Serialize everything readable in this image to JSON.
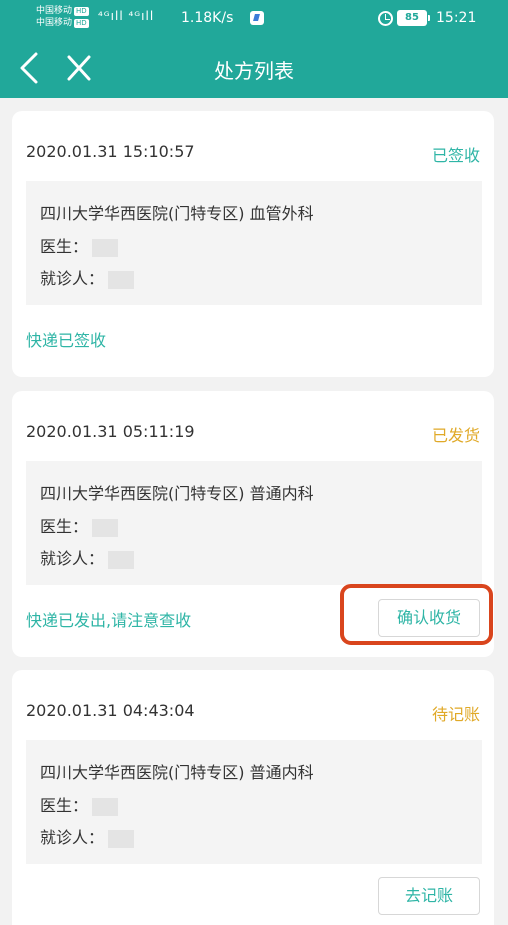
{
  "status_bar": {
    "carrier_1": "中国移动",
    "carrier_2": "中国移动",
    "hd": "HD",
    "signal": "⁴ᴳıll ⁴ᴳıll",
    "net_speed": "1.18K/s",
    "battery": "85",
    "time": "15:21"
  },
  "nav": {
    "title": "处方列表"
  },
  "prescriptions": [
    {
      "datetime": "2020.01.31 15:10:57",
      "status": "已签收",
      "status_color": "#2fb5a6",
      "hospital": "四川大学华西医院(门特专区) 血管外科",
      "doctor_label": "医生：",
      "patient_label": "就诊人：",
      "delivery": "快递已签收"
    },
    {
      "datetime": "2020.01.31 05:11:19",
      "status": "已发货",
      "status_color": "#e0a928",
      "hospital": "四川大学华西医院(门特专区) 普通内科",
      "doctor_label": "医生：",
      "patient_label": "就诊人：",
      "delivery": "快递已发出,请注意查收",
      "action": "确认收货"
    },
    {
      "datetime": "2020.01.31 04:43:04",
      "status": "待记账",
      "status_color": "#e0a928",
      "hospital": "四川大学华西医院(门特专区) 普通内科",
      "doctor_label": "医生：",
      "patient_label": "就诊人：",
      "action": "去记账"
    }
  ],
  "highlight_color": "#d9451d"
}
